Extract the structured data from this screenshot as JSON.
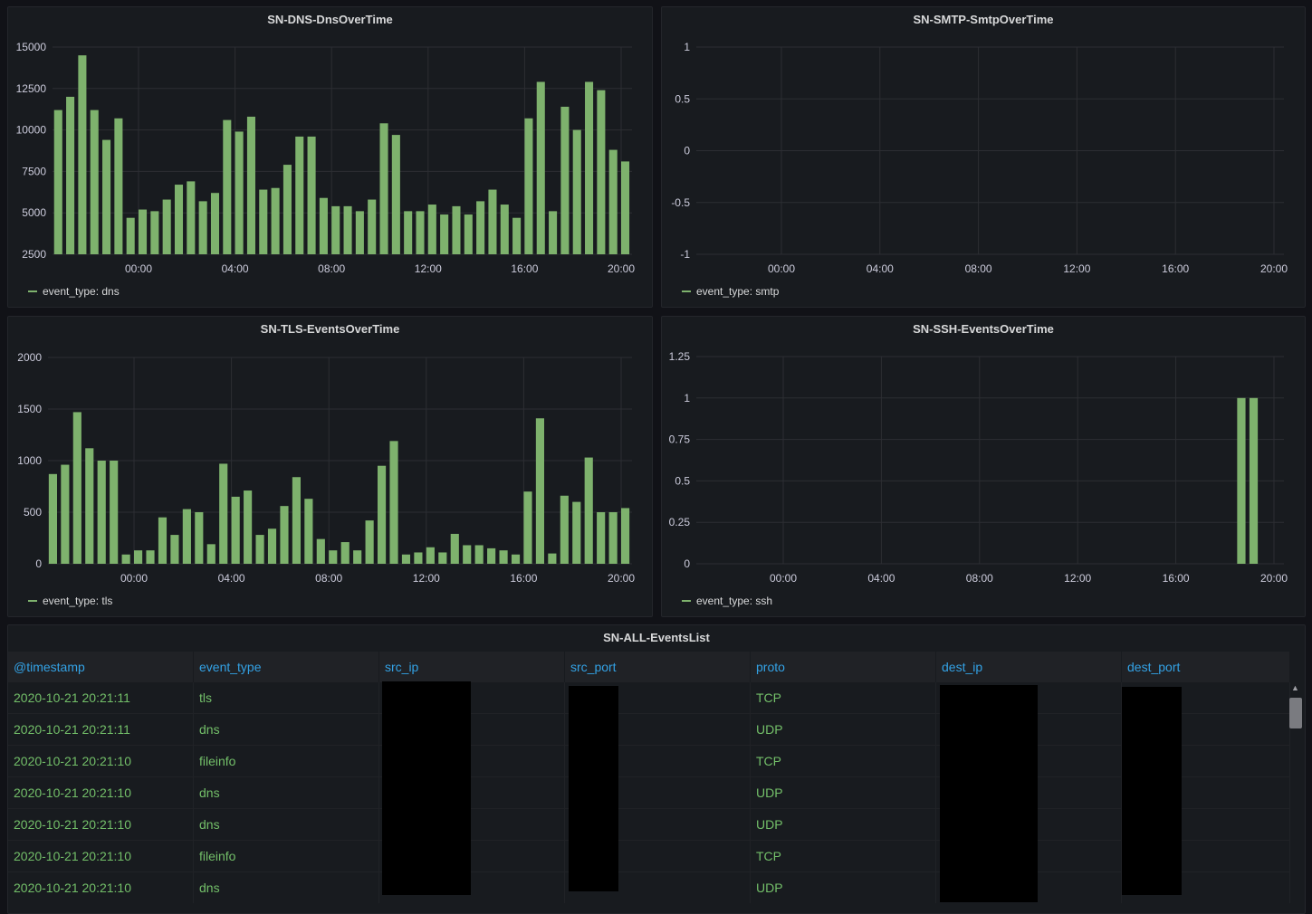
{
  "colors": {
    "bar": "#7eb26d",
    "grid": "#2c2e33",
    "axis_text": "#ccccdc",
    "header_text": "#33a2e5",
    "cell_text": "#73bf69"
  },
  "panels": {
    "dns": {
      "title": "SN-DNS-DnsOverTime",
      "legend": "event_type: dns"
    },
    "smtp": {
      "title": "SN-SMTP-SmtpOverTime",
      "legend": "event_type: smtp"
    },
    "tls": {
      "title": "SN-TLS-EventsOverTime",
      "legend": "event_type: tls"
    },
    "ssh": {
      "title": "SN-SSH-EventsOverTime",
      "legend": "event_type: ssh"
    }
  },
  "chart_data": [
    {
      "id": "dns",
      "type": "bar",
      "title": "SN-DNS-DnsOverTime",
      "ylim": [
        2500,
        15000
      ],
      "yticks": [
        "15000",
        "12500",
        "10000",
        "7500",
        "5000",
        "2500"
      ],
      "ytick_values": [
        15000,
        12500,
        10000,
        7500,
        5000,
        2500
      ],
      "xticks": [
        "00:00",
        "04:00",
        "08:00",
        "12:00",
        "16:00",
        "20:00"
      ],
      "x_start_hours": -3.33,
      "step_hours": 0.5,
      "series": [
        {
          "name": "event_type: dns",
          "values": [
            11200,
            12000,
            14500,
            11200,
            9400,
            10700,
            4700,
            5200,
            5100,
            5800,
            6700,
            6900,
            5700,
            6200,
            10600,
            9900,
            10800,
            6400,
            6500,
            7900,
            9600,
            9600,
            5900,
            5400,
            5400,
            5100,
            5800,
            10400,
            9700,
            5100,
            5100,
            5500,
            4900,
            5400,
            4900,
            5700,
            6400,
            5500,
            4700,
            10700,
            12900,
            5100,
            11400,
            10000,
            12900,
            12400,
            8800,
            8100
          ]
        }
      ]
    },
    {
      "id": "smtp",
      "type": "bar",
      "title": "SN-SMTP-SmtpOverTime",
      "ylim": [
        -1,
        1
      ],
      "yticks": [
        "1",
        "0.5",
        "0",
        "-0.5",
        "-1"
      ],
      "ytick_values": [
        1,
        0.5,
        0,
        -0.5,
        -1
      ],
      "xticks": [
        "00:00",
        "04:00",
        "08:00",
        "12:00",
        "16:00",
        "20:00"
      ],
      "x_start_hours": -3.33,
      "step_hours": 0.5,
      "series": [
        {
          "name": "event_type: smtp",
          "values": []
        }
      ]
    },
    {
      "id": "tls",
      "type": "bar",
      "title": "SN-TLS-EventsOverTime",
      "ylim": [
        0,
        2000
      ],
      "yticks": [
        "2000",
        "1500",
        "1000",
        "500",
        "0"
      ],
      "ytick_values": [
        2000,
        1500,
        1000,
        500,
        0
      ],
      "xticks": [
        "00:00",
        "04:00",
        "08:00",
        "12:00",
        "16:00",
        "20:00"
      ],
      "x_start_hours": -3.33,
      "step_hours": 0.5,
      "series": [
        {
          "name": "event_type: tls",
          "values": [
            870,
            960,
            1470,
            1120,
            1000,
            1000,
            90,
            130,
            130,
            450,
            280,
            530,
            500,
            190,
            970,
            650,
            710,
            280,
            340,
            560,
            840,
            630,
            240,
            130,
            210,
            130,
            420,
            950,
            1190,
            90,
            110,
            160,
            110,
            290,
            180,
            180,
            150,
            130,
            90,
            700,
            1410,
            100,
            660,
            600,
            1030,
            500,
            500,
            540
          ]
        }
      ]
    },
    {
      "id": "ssh",
      "type": "bar",
      "title": "SN-SSH-EventsOverTime",
      "ylim": [
        0,
        1.25
      ],
      "yticks": [
        "1.25",
        "1",
        "0.75",
        "0.5",
        "0.25",
        "0"
      ],
      "ytick_values": [
        1.25,
        1,
        0.75,
        0.5,
        0.25,
        0
      ],
      "xticks": [
        "00:00",
        "04:00",
        "08:00",
        "12:00",
        "16:00",
        "20:00"
      ],
      "x_start_hours": -3.33,
      "step_hours": 0.5,
      "series": [
        {
          "name": "event_type: ssh",
          "values": [
            0,
            0,
            0,
            0,
            0,
            0,
            0,
            0,
            0,
            0,
            0,
            0,
            0,
            0,
            0,
            0,
            0,
            0,
            0,
            0,
            0,
            0,
            0,
            0,
            0,
            0,
            0,
            0,
            0,
            0,
            0,
            0,
            0,
            0,
            0,
            0,
            0,
            0,
            0,
            0,
            0,
            0,
            0,
            0,
            1,
            1,
            0,
            0
          ]
        }
      ]
    }
  ],
  "table": {
    "title": "SN-ALL-EventsList",
    "columns": [
      "@timestamp",
      "event_type",
      "src_ip",
      "src_port",
      "proto",
      "dest_ip",
      "dest_port"
    ],
    "rows": [
      {
        "timestamp": "2020-10-21 20:21:11",
        "event_type": "tls",
        "proto": "TCP"
      },
      {
        "timestamp": "2020-10-21 20:21:11",
        "event_type": "dns",
        "proto": "UDP"
      },
      {
        "timestamp": "2020-10-21 20:21:10",
        "event_type": "fileinfo",
        "proto": "TCP"
      },
      {
        "timestamp": "2020-10-21 20:21:10",
        "event_type": "dns",
        "proto": "UDP"
      },
      {
        "timestamp": "2020-10-21 20:21:10",
        "event_type": "dns",
        "proto": "UDP"
      },
      {
        "timestamp": "2020-10-21 20:21:10",
        "event_type": "fileinfo",
        "proto": "TCP"
      },
      {
        "timestamp": "2020-10-21 20:21:10",
        "event_type": "dns",
        "proto": "UDP"
      }
    ]
  }
}
